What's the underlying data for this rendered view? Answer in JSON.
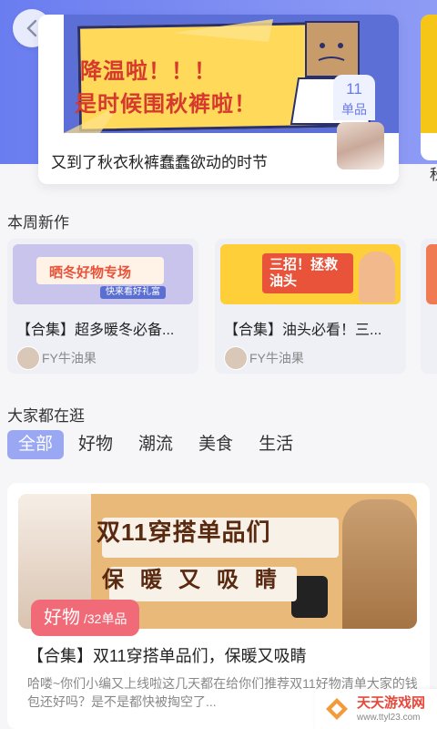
{
  "hero": {
    "banner_line1": "降温啦！！！",
    "banner_line2": "是时候围秋裤啦！",
    "caption": "又到了秋衣秋裤蠢蠢欲动的时节",
    "count": "11",
    "count_unit": "单品",
    "peek_text": "秋"
  },
  "new_this_week": {
    "title": "本周新作",
    "cards": [
      {
        "banner_text": "晒冬好物专场",
        "banner_sub": "快来看好礼富",
        "title": "【合集】超多暖冬必备...",
        "author": "FY牛油果"
      },
      {
        "banner_text": "三招！拯救油头",
        "title": "【合集】油头必看！三...",
        "author": "FY牛油果"
      }
    ]
  },
  "browsing": {
    "title": "大家都在逛",
    "tabs": [
      "全部",
      "好物",
      "潮流",
      "美食",
      "生活"
    ],
    "active_tab": "全部"
  },
  "feed": {
    "banner_headline": "双11穿搭单品们",
    "banner_sub": "保暖又吸睛",
    "tag": "好物",
    "tag_sub": "/32单品",
    "title": "【合集】双11穿搭单品们，保暖又吸睛",
    "desc": "哈喽~你们小编又上线啦这几天都在给你们推荐双11好物清单大家的钱包还好吗？是不是都快被掏空了..."
  },
  "watermark": {
    "title": "天天游戏网",
    "url": "www.ttyl23.com"
  },
  "colors": {
    "accent": "#9aa8f3",
    "top_gradient": "#6a7df0",
    "tag": "#f06b77"
  }
}
